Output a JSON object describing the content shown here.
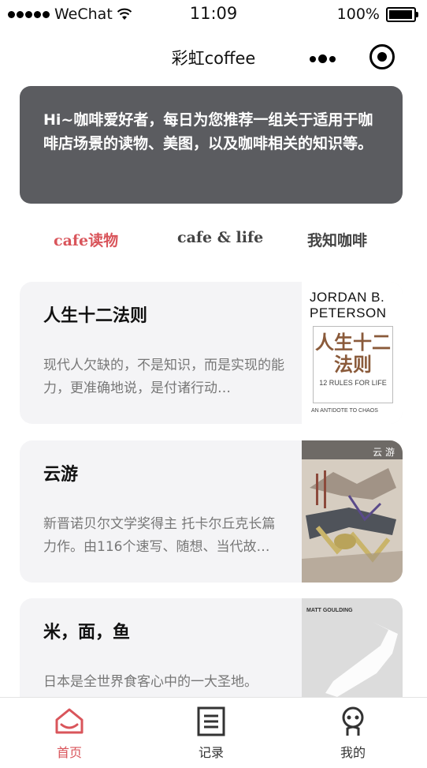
{
  "status_bar": {
    "carrier": "WeChat",
    "time": "11:09",
    "battery": "100%"
  },
  "navbar": {
    "title": "彩虹coffee"
  },
  "intro": {
    "text": "Hi~咖啡爱好者，每日为您推荐一组关于适用于咖啡店场景的读物、美图，以及咖啡相关的知识等。"
  },
  "tabs": [
    {
      "label": "cafe读物",
      "active": true
    },
    {
      "label": "cafe & life",
      "active": false
    },
    {
      "label": "我知咖啡",
      "active": false
    }
  ],
  "books": [
    {
      "title": "人生十二法则",
      "desc": "现代人欠缺的，不是知识，而是实现的能力，更准确地说，是付诸行动…",
      "cover": {
        "author": "JORDAN B. PETERSON",
        "zh_title": "人生十二法则",
        "en_title": "12 RULES FOR LIFE",
        "footer": "AN ANTIDOTE TO CHAOS"
      }
    },
    {
      "title": "云游",
      "desc": "新晋诺贝尔文学奖得主 托卡尔丘克长篇力作。由116个速写、随想、当代故…",
      "cover": {
        "zh_title": "云 游"
      }
    },
    {
      "title": "米，面，鱼",
      "desc": "日本是全世界食客心中的一大圣地。",
      "cover": {
        "author": "MATT GOULDING"
      }
    }
  ],
  "tabbar": [
    {
      "label": "首页",
      "icon": "home-icon",
      "active": true
    },
    {
      "label": "记录",
      "icon": "document-icon",
      "active": false
    },
    {
      "label": "我的",
      "icon": "profile-icon",
      "active": false
    }
  ],
  "colors": {
    "accent": "#d9555b",
    "banner": "#5b5c60",
    "card": "#f4f4f6"
  }
}
